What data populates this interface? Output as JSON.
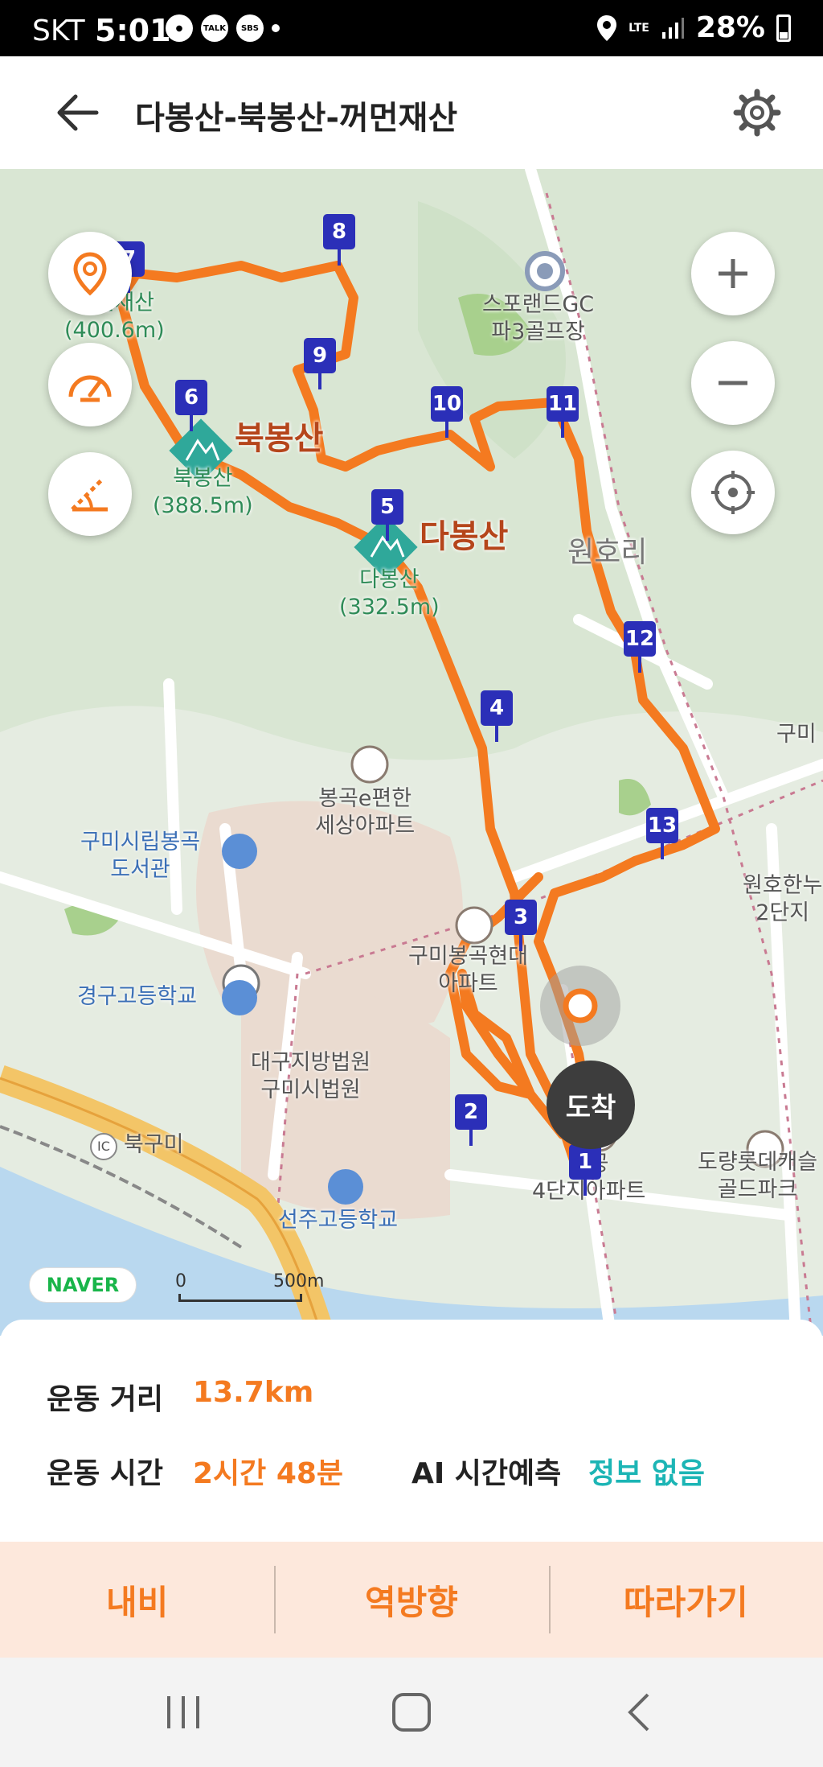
{
  "status_bar": {
    "carrier": "SKT",
    "time": "5:01",
    "notif_icons": [
      "sbs-icon",
      "talk-icon",
      "sbs-news-icon"
    ],
    "talk_label": "TALK",
    "sbs_label": "SBS",
    "network": "LTE",
    "battery": "28%"
  },
  "header": {
    "title": "다봉산-북봉산-꺼먼재산"
  },
  "map": {
    "labels": {
      "sports_land": "스포랜드GC\n파3골프장",
      "bukbongsan_peak": "북봉산",
      "bukbongsan_name": "북봉산\n(388.5m)",
      "dabongsan_peak": "다봉산",
      "dabongsan_name": "다봉산\n(332.5m)",
      "kkeomeon": "꺼먼재산\n(400.6m)",
      "wonhori": "원호리",
      "apt1": "봉곡e편한\n세상아파트",
      "library": "구미시립봉곡\n도서관",
      "apt2": "구미봉곡현대\n아파트",
      "school": "경구고등학교",
      "court": "대구지방법원\n구미시법원",
      "apt3": "주공\n4단지아파트",
      "seonju_school": "선주고등학교",
      "bukgumi": "북구미",
      "ic": "IC",
      "dorang": "도량롯데캐슬\n골드파크",
      "wonho_apt": "원호한누\n2단지",
      "gumi_edge": "구미"
    },
    "markers": [
      "1",
      "2",
      "3",
      "4",
      "5",
      "6",
      "7",
      "8",
      "9",
      "10",
      "11",
      "12",
      "13"
    ],
    "arrival": "도착",
    "naver": "NAVER",
    "scale_zero": "0",
    "scale_500": "500m",
    "colors": {
      "route": "#f47a20",
      "marker": "#2b2fb8",
      "peak": "#2fa89a"
    }
  },
  "info": {
    "distance_label": "운동 거리",
    "distance_value": "13.7km",
    "time_label": "운동 시간",
    "time_value": "2시간 48분",
    "ai_label": "AI 시간예측",
    "ai_value": "정보 없음"
  },
  "actions": {
    "navi": "내비",
    "reverse": "역방향",
    "follow": "따라가기"
  }
}
